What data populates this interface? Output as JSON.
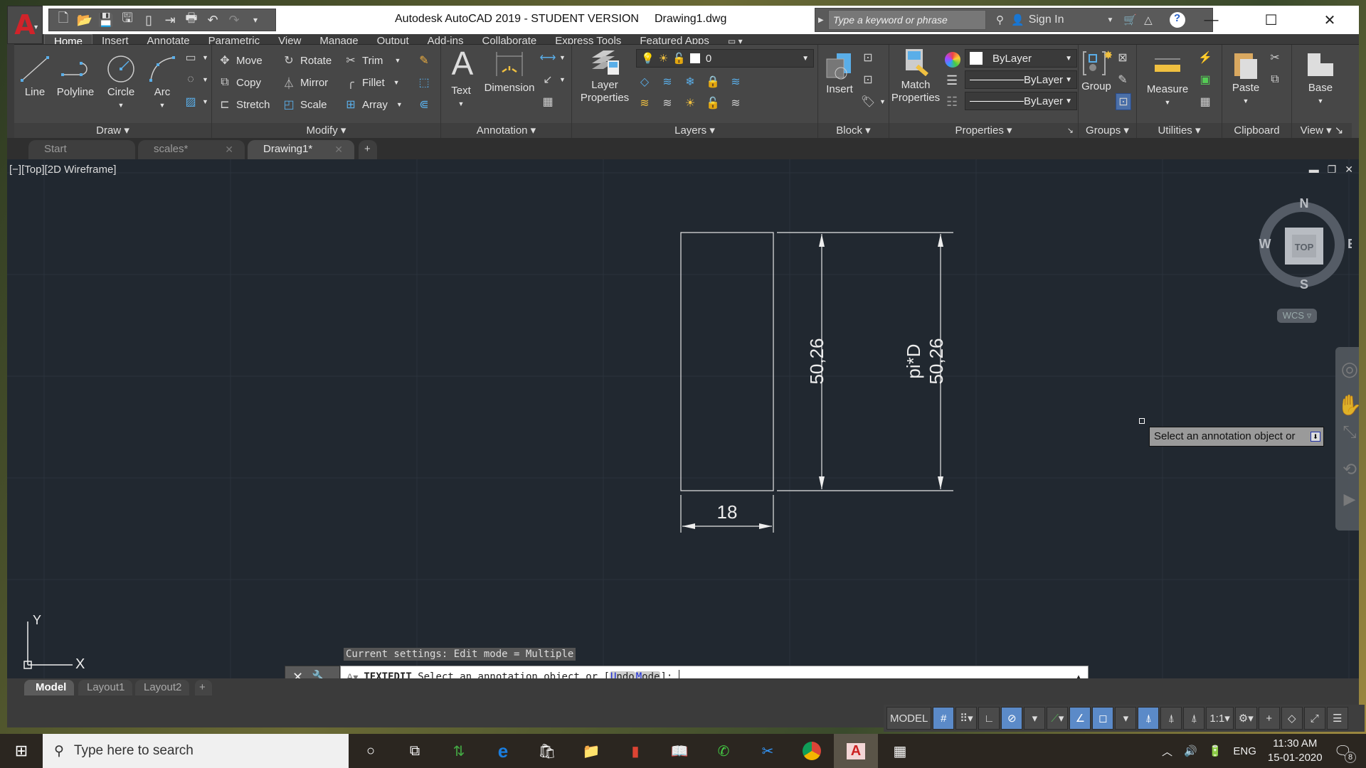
{
  "window": {
    "app_title": "Autodesk AutoCAD 2019 - STUDENT VERSION",
    "document": "Drawing1.dwg",
    "app_logo": "A"
  },
  "search": {
    "placeholder": "Type a keyword or phrase"
  },
  "account": {
    "sign_in": "Sign In"
  },
  "ribbon_tabs": [
    "Home",
    "Insert",
    "Annotate",
    "Parametric",
    "View",
    "Manage",
    "Output",
    "Add-ins",
    "Collaborate",
    "Express Tools",
    "Featured Apps"
  ],
  "active_ribbon_tab": "Home",
  "panels": {
    "draw": {
      "label": "Draw",
      "tools": [
        "Line",
        "Polyline",
        "Circle",
        "Arc"
      ]
    },
    "modify": {
      "label": "Modify",
      "tools": [
        "Move",
        "Rotate",
        "Trim",
        "Copy",
        "Mirror",
        "Fillet",
        "Stretch",
        "Scale",
        "Array"
      ]
    },
    "annotation": {
      "label": "Annotation",
      "tools": [
        "Text",
        "Dimension"
      ]
    },
    "layers": {
      "label": "Layers",
      "tool": "Layer Properties",
      "tool_line1": "Layer",
      "tool_line2": "Properties",
      "current_layer": "0"
    },
    "block": {
      "label": "Block",
      "tool": "Insert"
    },
    "properties": {
      "label": "Properties",
      "tool_line1": "Match",
      "tool_line2": "Properties",
      "color": "ByLayer",
      "linetype": "ByLayer",
      "lineweight": "ByLayer"
    },
    "groups": {
      "label": "Groups",
      "tool": "Group"
    },
    "utilities": {
      "label": "Utilities",
      "tool": "Measure"
    },
    "clipboard": {
      "label": "Clipboard",
      "tool": "Paste"
    },
    "view": {
      "label": "View",
      "tool": "Base"
    }
  },
  "file_tabs": [
    {
      "label": "Start",
      "closable": false,
      "active": false
    },
    {
      "label": "scales*",
      "closable": true,
      "active": false
    },
    {
      "label": "Drawing1*",
      "closable": true,
      "active": true
    }
  ],
  "viewport": {
    "label": "[−][Top][2D Wireframe]",
    "dimensions": {
      "width_dim": "18",
      "height_dim": "50,26",
      "circ_dim_line1": "pi*D",
      "circ_dim_line2": "50,26"
    },
    "viewcube": {
      "n": "N",
      "s": "S",
      "e": "E",
      "w": "W",
      "face": "TOP",
      "ucs": "WCS"
    },
    "ucs_labels": {
      "x": "X",
      "y": "Y"
    },
    "tooltip": "Select an annotation object or"
  },
  "command": {
    "history": "Current settings: Edit mode = Multiple",
    "name": "TEXTEDIT",
    "prompt": " Select an annotation object or [",
    "options": [
      {
        "key": "U",
        "rest": "ndo"
      },
      {
        "key": "M",
        "rest": "ode"
      }
    ],
    "suffix": "]: "
  },
  "layout_tabs": [
    "Model",
    "Layout1",
    "Layout2"
  ],
  "active_layout": "Model",
  "statusbar": {
    "space": "MODEL",
    "scale": "1:1"
  },
  "taskbar": {
    "search_placeholder": "Type here to search",
    "language": "ENG",
    "time": "11:30 AM",
    "date": "15-01-2020",
    "notifications": "8"
  }
}
